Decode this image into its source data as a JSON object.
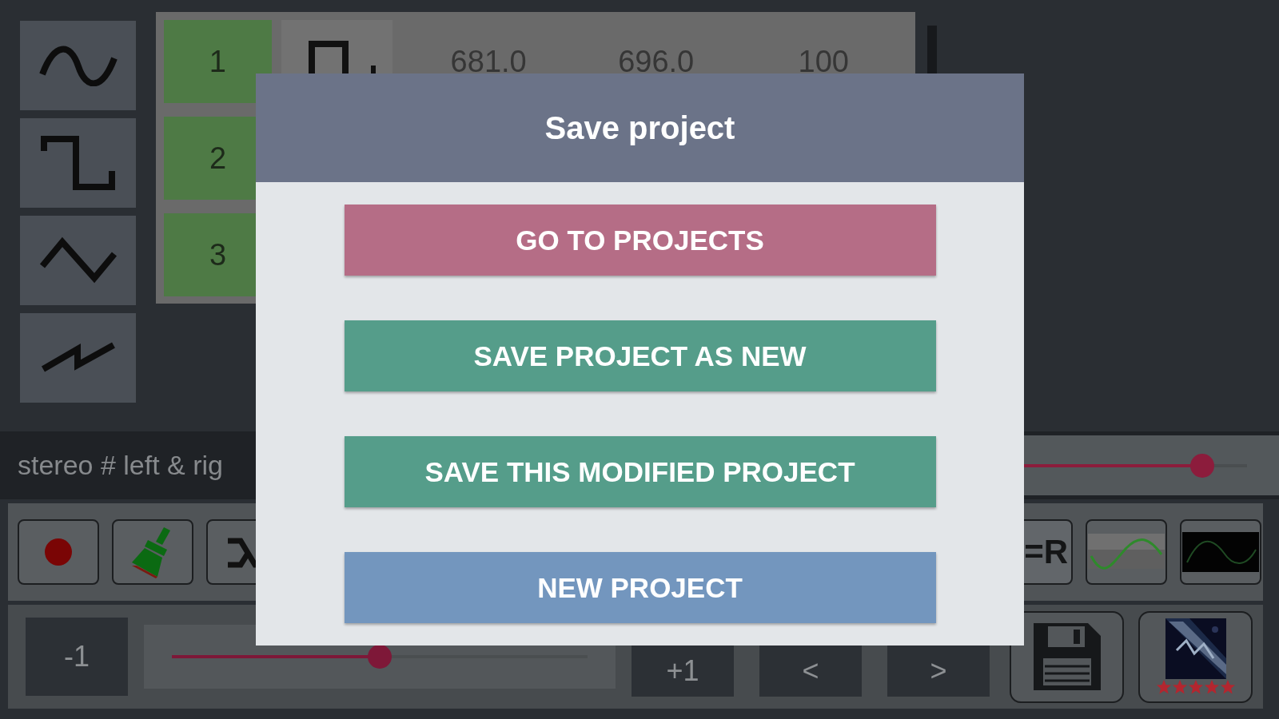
{
  "wave_buttons": [
    {
      "kind": "sine"
    },
    {
      "kind": "square"
    },
    {
      "kind": "triangle"
    },
    {
      "kind": "saw"
    }
  ],
  "tracks": [
    {
      "number": "1",
      "values": [
        "681.0",
        "696.0",
        "100"
      ]
    },
    {
      "number": "2"
    },
    {
      "number": "3"
    }
  ],
  "stereo": {
    "label": "stereo # left & rig",
    "level": 0.8
  },
  "toolbar": {
    "mode_label": "=R"
  },
  "bottom": {
    "minus": "-1",
    "level": 0.5,
    "plus": "+1",
    "prev": "<",
    "next": ">"
  },
  "rating": {
    "stars": 5
  },
  "dialog": {
    "title": "Save project",
    "buttons": [
      {
        "label": "GO TO PROJECTS",
        "color": "#b56d86"
      },
      {
        "label": "SAVE PROJECT AS NEW",
        "color": "#559d8a"
      },
      {
        "label": "SAVE THIS MODIFIED PROJECT",
        "color": "#559d8a"
      },
      {
        "label": "NEW PROJECT",
        "color": "#7396be"
      }
    ]
  }
}
